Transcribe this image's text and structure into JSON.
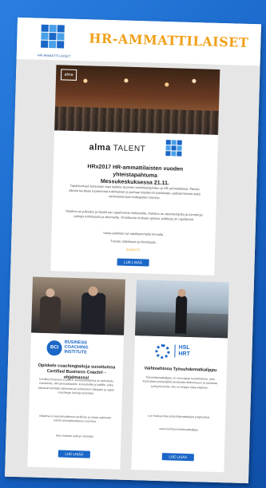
{
  "header": {
    "title": "HR-AMMATTILAISET",
    "logo_caption": "HR-AMMATTILAISET"
  },
  "main_card": {
    "hero_mark": "alma",
    "alma_logo": "TALENT",
    "alma_prefix": "alma",
    "heading_line1": "HRx2017 HR-ammattilaisten vuoden yhteistapahtuma",
    "heading_line2": "Messukeskuksessa 21.11.",
    "para1": "Tapahtumaan kutsutaan taas kaikkia Suomen henkilöstöjohdon ja HR-ammattilaisia. Päivän aikana kuullaan tuoreimmat tutkimukset ja parhaat käytännöt työelämän uudistamisesta sekä verkostoidutaan kollegoiden kanssa.",
    "para2": "Ohjelma on julkaistu ja löydät sen tapahtuman kotisivuilta. Mukana on asiantuntijoita ja tunnettuja puhujia kotimaasta ja ulkomailta. Ilmoittaudu mukaan ajoissa, paikkoja on rajoitetusti.",
    "para3": "Varaa paikkasi nyt edullisemmalla hinnalla.",
    "para4": "Tutustu ohjelmaan ja ilmoittaudu",
    "link": "hrx2017.fi",
    "button": "LUE LISÄÄ"
  },
  "card_left": {
    "logo_badge": "BCI",
    "logo_line1": "BUSINESS",
    "logo_line2": "COACHING",
    "logo_line3": "INSTITUTE",
    "heading_line1": "Opiskele coachingtaitoja suosituissa",
    "heading_line2": "Certified Business Coach® -ohjelmassa!",
    "para1": "Certified Business Coach® -koulutusohjelma on tarkoitettu esimiehille, HR-ammattilaisille, konsulteille ja kaikille, jotka haluavat kehittää valmentavan johtamisen taitojaan ja oppia coachingin keinoja työssään.",
    "para2": "Ohjelma on kansainvälisesti sertifioitu ja antaa valmiudet toimia ammattimaisena coachina.",
    "link": "Hae mukaan syksyn ryhmään",
    "button": "LUE LISÄÄ"
  },
  "card_right": {
    "logo_line1": "HSL",
    "logo_line2": "HRT",
    "heading_line1": "Vaihtoehtona Työsuhdematkalippu",
    "para1": "Työsuhdematkalippu on verovapaa henkilöstöetu, joka kannustaa työntekijöitä kestävään liikkumiseen ja parantaa työhyvinvointia. Etu on helppo ottaa käyttöön.",
    "para2": "Lue lisää ja tilaa työsuhdematkaliput yrityksellesi.",
    "link": "www.hsl.fi/tyosuhdematkalippu",
    "button": "LUE LISÄÄ"
  },
  "colors": {
    "accent": "#f0a019",
    "brand_blue": "#1b67c7",
    "background": "#1f6fd0"
  }
}
